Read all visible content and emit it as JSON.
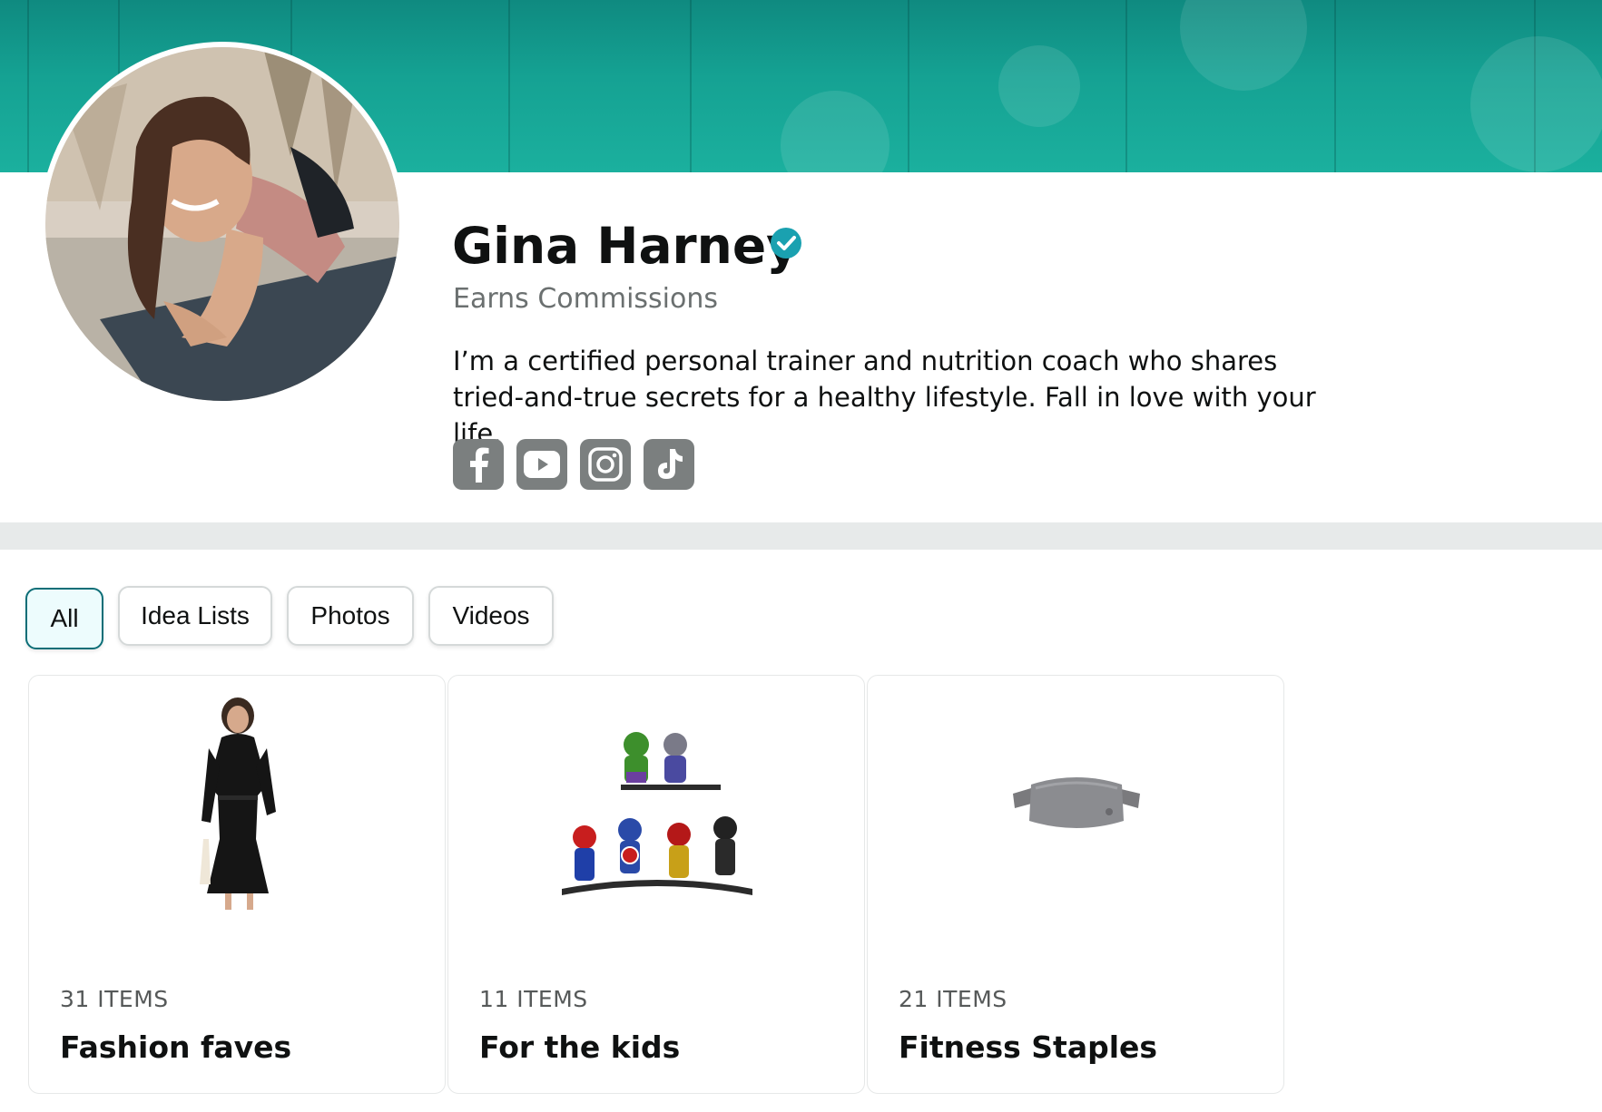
{
  "profile": {
    "name": "Gina Harney",
    "earns_label": "Earns Commissions",
    "bio": "I’m a certified personal trainer and nutrition coach who shares tried-and-true secrets for a healthy lifestyle. Fall in love with your life.",
    "verified_icon": "verified-check-icon",
    "socials": [
      {
        "icon": "facebook-icon"
      },
      {
        "icon": "youtube-icon"
      },
      {
        "icon": "instagram-icon"
      },
      {
        "icon": "tiktok-icon"
      }
    ]
  },
  "filters": [
    {
      "label": "All",
      "active": true
    },
    {
      "label": "Idea Lists",
      "active": false
    },
    {
      "label": "Photos",
      "active": false
    },
    {
      "label": "Videos",
      "active": false
    }
  ],
  "lists": [
    {
      "count": "31 ITEMS",
      "title": "Fashion faves",
      "image": "black-dress-image"
    },
    {
      "count": "11 ITEMS",
      "title": "For the kids",
      "image": "superhero-figures-image"
    },
    {
      "count": "21 ITEMS",
      "title": "Fitness Staples",
      "image": "belt-bag-image"
    }
  ],
  "colors": {
    "banner": "#15a293",
    "verified": "#1aa1b0",
    "social_bg": "#7b7f7f",
    "active_pill_border": "#0b6e77",
    "active_pill_bg": "#edfcfd"
  }
}
